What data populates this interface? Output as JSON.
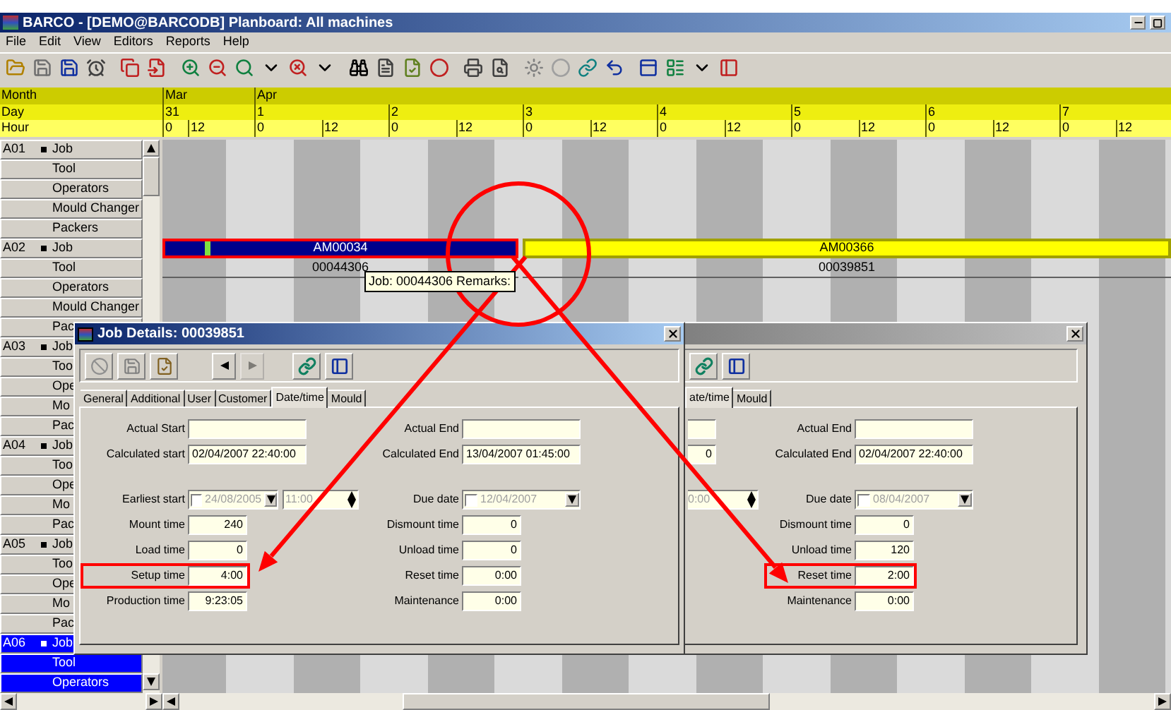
{
  "window": {
    "title": "BARCO - [DEMO@BARCODB] Planboard: All machines"
  },
  "menu": [
    "File",
    "Edit",
    "View",
    "Editors",
    "Reports",
    "Help"
  ],
  "timeline": {
    "row_labels": [
      "Month",
      "Day",
      "Hour"
    ],
    "months": [
      {
        "label": "Mar",
        "days": [
          {
            "label": "31",
            "hours": [
              "0",
              "12"
            ]
          }
        ]
      },
      {
        "label": "Apr",
        "days": [
          {
            "label": "1",
            "hours": [
              "0",
              "12"
            ]
          },
          {
            "label": "2",
            "hours": [
              "0",
              "12"
            ]
          },
          {
            "label": "3",
            "hours": [
              "0",
              "12"
            ]
          },
          {
            "label": "4",
            "hours": [
              "0",
              "12"
            ]
          },
          {
            "label": "5",
            "hours": [
              "0",
              "12"
            ]
          },
          {
            "label": "6",
            "hours": [
              "0",
              "12"
            ]
          },
          {
            "label": "7",
            "hours": [
              "0",
              "12"
            ]
          }
        ]
      }
    ]
  },
  "machines": [
    {
      "code": "A01",
      "selected": false,
      "resources": [
        "Job",
        "Tool",
        "Operators",
        "Mould Changer",
        "Packers"
      ]
    },
    {
      "code": "A02",
      "selected": false,
      "resources": [
        "Job",
        "Tool",
        "Operators",
        "Mould Changer",
        "Pac"
      ],
      "jobs": [
        {
          "label": "AM00034",
          "order": "00044306",
          "color": "#00008b",
          "selected": true
        },
        {
          "label": "AM00366",
          "order": "00039851",
          "color": "#ffff00",
          "selected": false
        }
      ]
    },
    {
      "code": "A03",
      "selected": false,
      "resources": [
        "Job",
        "Too",
        "Ope",
        "Mo",
        "Pac"
      ]
    },
    {
      "code": "A04",
      "selected": false,
      "resources": [
        "Job",
        "Too",
        "Ope",
        "Mo",
        "Pac"
      ]
    },
    {
      "code": "A05",
      "selected": false,
      "resources": [
        "Job",
        "Too",
        "Ope",
        "Mo",
        "Pac"
      ]
    },
    {
      "code": "A06",
      "selected": true,
      "resources": [
        "Job",
        "Tool",
        "Operators"
      ]
    }
  ],
  "tooltip": "Job: 00044306 Remarks:",
  "dialogs": [
    {
      "kind": "full",
      "active": true,
      "title": "Job Details: 00039851",
      "tabs": [
        {
          "label": "General",
          "selected": false
        },
        {
          "label": "Additional",
          "selected": false
        },
        {
          "label": "User",
          "selected": false
        },
        {
          "label": "Customer",
          "selected": false
        },
        {
          "label": "Date/time",
          "selected": true
        },
        {
          "label": "Mould",
          "selected": false
        }
      ],
      "sections": [
        {
          "rows": [
            {
              "left": {
                "kind": "text",
                "label": "Actual Start"
              },
              "right": {
                "kind": "text",
                "label": "Actual End"
              }
            },
            {
              "left": {
                "kind": "text",
                "label": "Calculated start",
                "value": "02/04/2007 22:40:00"
              },
              "right": {
                "kind": "text",
                "label": "Calculated End",
                "value": "13/04/2007 01:45:00"
              }
            }
          ]
        },
        {
          "rows": [
            {
              "left": {
                "kind": "date",
                "label": "Earliest start",
                "checked": false,
                "value": "24/08/2005",
                "time": "11:00"
              },
              "right": {
                "kind": "date",
                "label": "Due date",
                "checked": false,
                "value": "12/04/2007"
              }
            },
            {
              "left": {
                "kind": "number",
                "label": "Mount time",
                "value": "240"
              },
              "right": {
                "kind": "number",
                "label": "Dismount time",
                "value": "0"
              }
            },
            {
              "left": {
                "kind": "number",
                "label": "Load time",
                "value": "0"
              },
              "right": {
                "kind": "number",
                "label": "Unload time",
                "value": "0"
              }
            },
            {
              "left": {
                "kind": "number",
                "label": "Setup time",
                "value": "4:00",
                "highlighted": true
              },
              "right": {
                "kind": "number",
                "label": "Reset time",
                "value": "0:00"
              }
            },
            {
              "left": {
                "kind": "number",
                "label": "Production time",
                "value": "9:23:05"
              },
              "right": {
                "kind": "number",
                "label": "Maintenance",
                "value": "0:00"
              }
            }
          ]
        }
      ]
    },
    {
      "kind": "partial",
      "active": false,
      "tabs": [
        {
          "label": "ate/time",
          "selected": true
        },
        {
          "label": "Mould",
          "selected": false
        }
      ],
      "sections": [
        {
          "rows": [
            {
              "left": {
                "kind": "stub"
              },
              "right": {
                "kind": "text",
                "label": "Actual End"
              }
            },
            {
              "left": {
                "kind": "stub",
                "value": "0"
              },
              "right": {
                "kind": "text",
                "label": "Calculated End",
                "value": "02/04/2007 22:40:00"
              }
            }
          ]
        },
        {
          "rows": [
            {
              "left": {
                "kind": "time-stub",
                "value": "0:00"
              },
              "right": {
                "kind": "date",
                "label": "Due date",
                "checked": false,
                "value": "08/04/2007"
              }
            },
            {
              "left": {
                "kind": "none"
              },
              "right": {
                "kind": "number",
                "label": "Dismount time",
                "value": "0"
              }
            },
            {
              "left": {
                "kind": "none"
              },
              "right": {
                "kind": "number",
                "label": "Unload time",
                "value": "120"
              }
            },
            {
              "left": {
                "kind": "none"
              },
              "right": {
                "kind": "number",
                "label": "Reset time",
                "value": "2:00",
                "highlighted": true
              }
            },
            {
              "left": {
                "kind": "none"
              },
              "right": {
                "kind": "number",
                "label": "Maintenance",
                "value": "0:00"
              }
            }
          ]
        }
      ]
    }
  ]
}
